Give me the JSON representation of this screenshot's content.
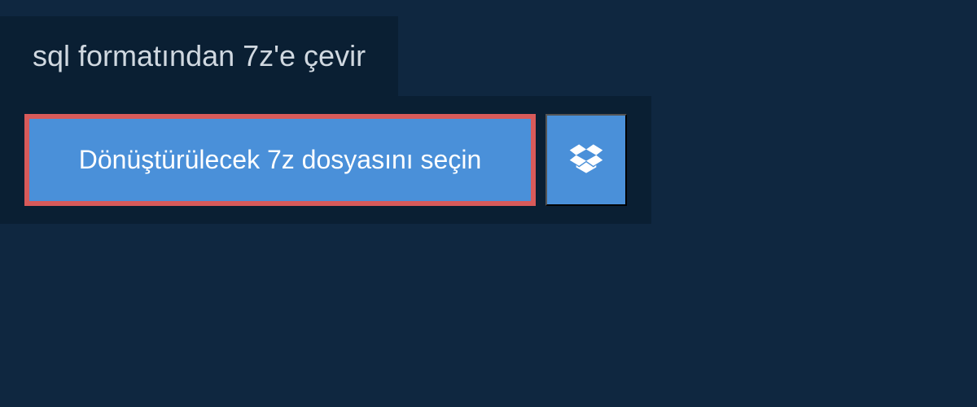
{
  "header": {
    "title": "sql formatından 7z'e çevir"
  },
  "upload": {
    "select_button_label": "Dönüştürülecek 7z dosyasını seçin"
  },
  "colors": {
    "page_bg": "#0f2740",
    "panel_bg": "#0a1f33",
    "button_bg": "#4a90d9",
    "button_border_highlight": "#d85a5a",
    "text_light": "#d0d8e0",
    "text_white": "#ffffff"
  }
}
